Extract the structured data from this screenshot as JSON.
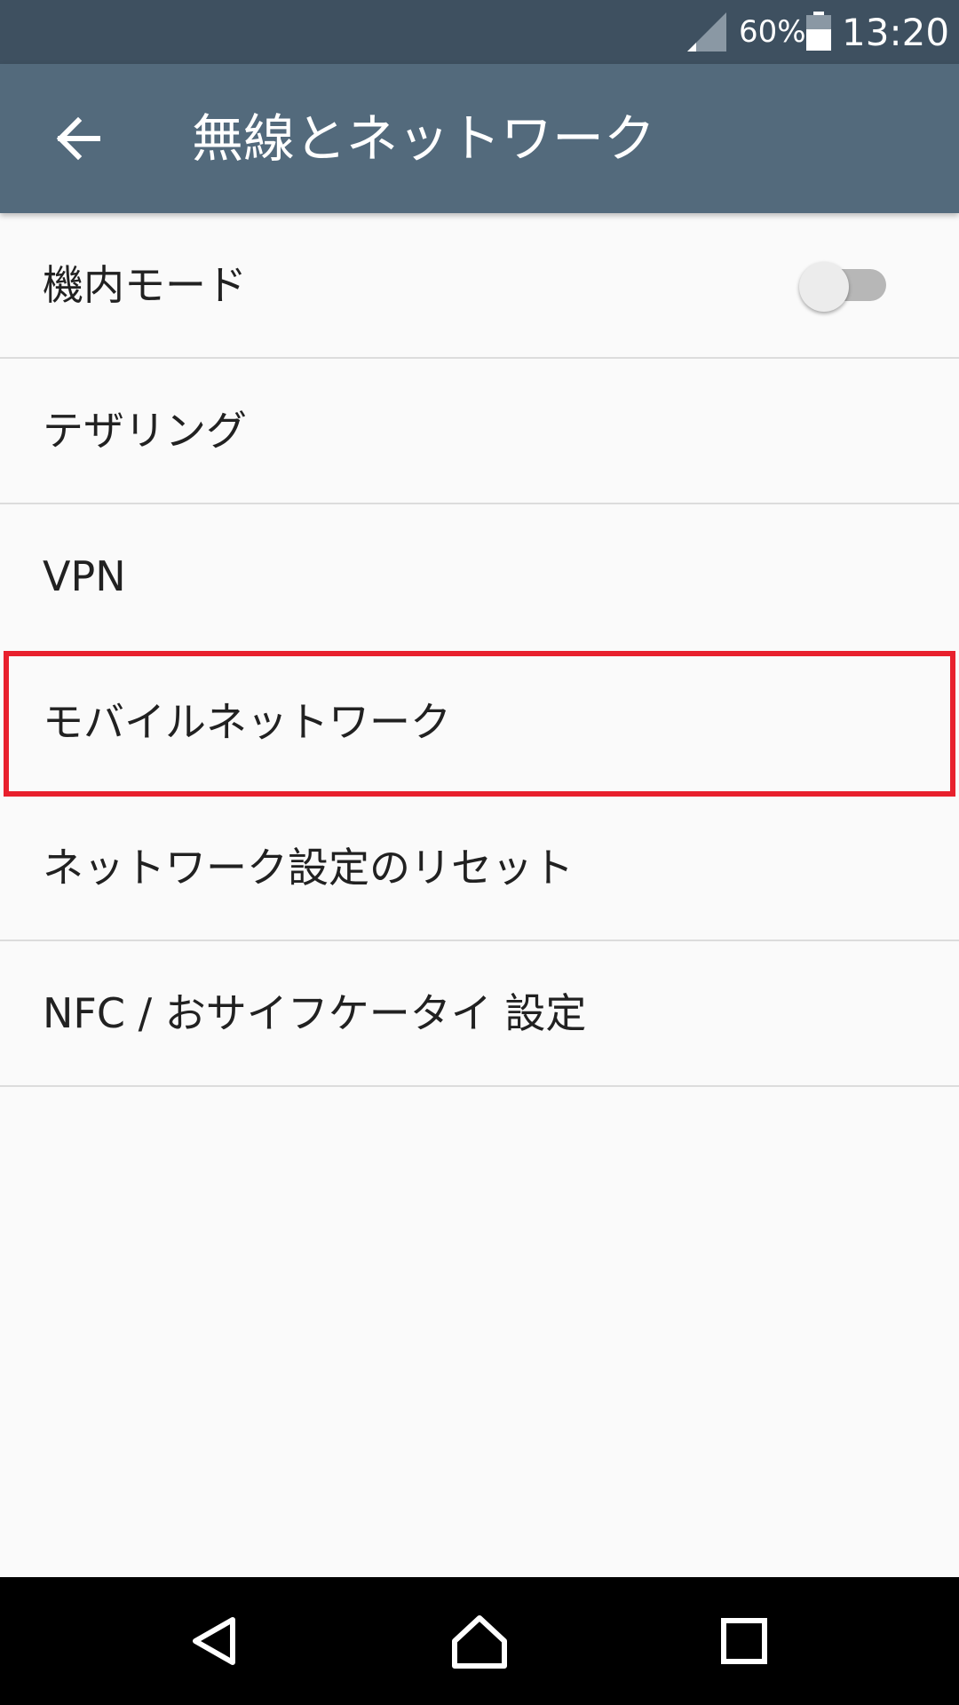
{
  "status_bar": {
    "battery_percent": "60%",
    "time": "13:20",
    "icons": [
      "signal-icon",
      "battery-icon"
    ]
  },
  "app_bar": {
    "title": "無線とネットワーク",
    "back_icon": "arrow-left-icon"
  },
  "settings": {
    "items": [
      {
        "label": "機内モード",
        "toggle": {
          "state": "off"
        }
      },
      {
        "label": "テザリング"
      },
      {
        "label": "VPN"
      },
      {
        "label": "モバイルネットワーク",
        "highlighted": true
      },
      {
        "label": "ネットワーク設定のリセット"
      },
      {
        "label": "NFC / おサイフケータイ 設定"
      }
    ]
  },
  "nav_bar": {
    "icons": [
      "back-triangle-icon",
      "home-icon",
      "recents-icon"
    ]
  },
  "colors": {
    "status_bar": "#3e5060",
    "app_bar": "#536a7c",
    "background": "#fafafa",
    "highlight": "#e8202d",
    "nav_bar": "#000000"
  }
}
